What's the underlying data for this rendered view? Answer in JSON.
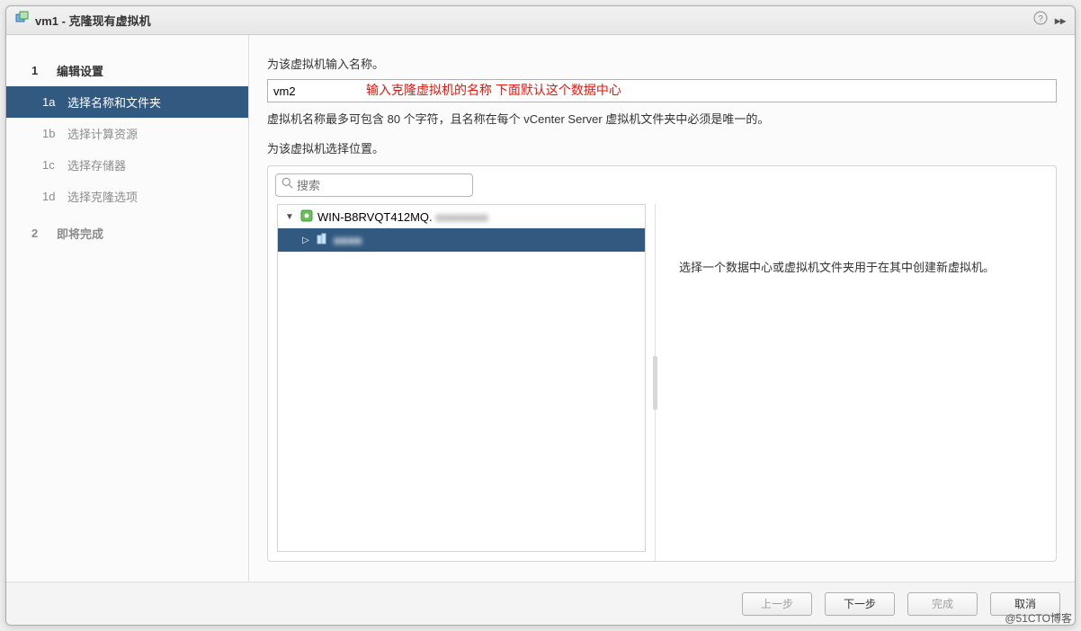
{
  "titlebar": {
    "title": "vm1 - 克隆现有虚拟机"
  },
  "sidebar": {
    "section1": {
      "num": "1",
      "label": "编辑设置"
    },
    "step_a": {
      "num": "1a",
      "label": "选择名称和文件夹"
    },
    "step_b": {
      "num": "1b",
      "label": "选择计算资源"
    },
    "step_c": {
      "num": "1c",
      "label": "选择存储器"
    },
    "step_d": {
      "num": "1d",
      "label": "选择克隆选项"
    },
    "section2": {
      "num": "2",
      "label": "即将完成"
    }
  },
  "main": {
    "name_prompt": "为该虚拟机输入名称。",
    "name_value": "vm2",
    "annotation": "输入克隆虚拟机的名称   下面默认这个数据中心",
    "name_hint": "虚拟机名称最多可包含 80 个字符，且名称在每个 vCenter Server 虚拟机文件夹中必须是唯一的。",
    "loc_prompt": "为该虚拟机选择位置。",
    "search_placeholder": "搜索",
    "tree": {
      "root_label": "WIN-B8RVQT412MQ.",
      "child_label": "■■■■"
    },
    "info_text": "选择一个数据中心或虚拟机文件夹用于在其中创建新虚拟机。"
  },
  "footer": {
    "back": "上一步",
    "next": "下一步",
    "finish": "完成",
    "cancel": "取消"
  },
  "watermark": "@51CTO博客"
}
